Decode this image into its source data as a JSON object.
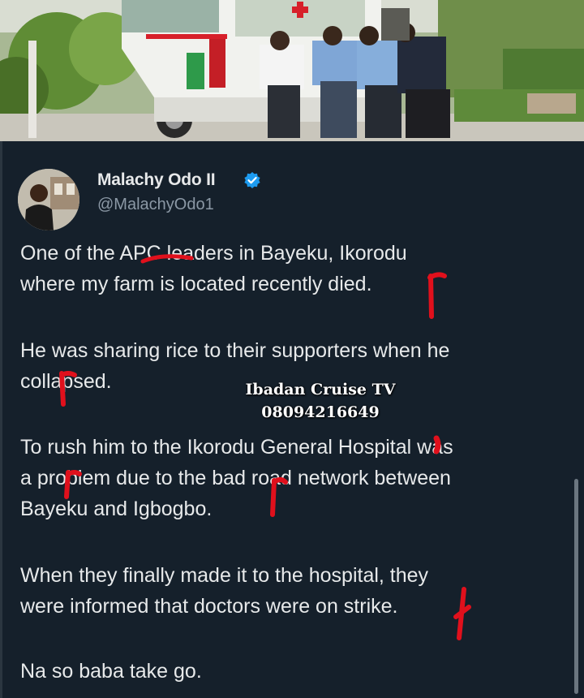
{
  "photo": {
    "description_icon": "ambulance-photo"
  },
  "tweet": {
    "display_name": "Malachy Odo II",
    "handle": "@MalachyOdo1",
    "verified_icon": "verified-badge-icon",
    "verified_color": "#1d9bf0",
    "paragraphs": [
      [
        "One of the APC leaders in Bayeku, Ikorodu",
        "where my farm is located recently died."
      ],
      [
        "He was sharing rice to their supporters when he",
        "collapsed."
      ],
      [
        "To rush him to the Ikorodu General Hospital was",
        "a problem due to the bad road network between",
        "Bayeku and Igbogbo."
      ],
      [
        "When they finally made it to the hospital, they",
        "were informed that doctors were on strike."
      ],
      [
        "Na so baba take go."
      ]
    ]
  },
  "watermark": {
    "line1": "Ibadan Cruise TV",
    "line2": "08094216649"
  },
  "colors": {
    "background": "#15202b",
    "text": "#e7e9ea",
    "secondary": "#8b98a5",
    "annotation": "#e0101c"
  }
}
